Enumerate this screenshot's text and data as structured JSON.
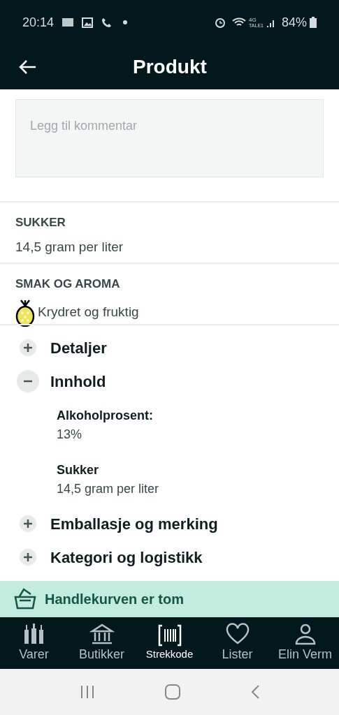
{
  "status_bar": {
    "time": "20:14",
    "network": "4G",
    "carrier": "TALE1",
    "battery": "84%"
  },
  "header": {
    "title": "Produkt"
  },
  "comment": {
    "placeholder": "Legg til kommentar"
  },
  "facts": [
    {
      "kind": "text",
      "label": "SUKKER",
      "value": "14,5 gram per liter"
    },
    {
      "kind": "flavor",
      "label": "SMAK OG AROMA",
      "value": "Krydret og fruktig"
    }
  ],
  "sections": [
    {
      "title": "Detaljer",
      "expanded": false
    },
    {
      "title": "Innhold",
      "expanded": true,
      "items": [
        {
          "label": "Alkoholprosent:",
          "value": "13%"
        },
        {
          "label": "Sukker",
          "value": "14,5 gram per liter"
        }
      ]
    },
    {
      "title": "Emballasje og merking",
      "expanded": false
    },
    {
      "title": "Kategori og logistikk",
      "expanded": false
    }
  ],
  "basket": {
    "text": "Handlekurven er tom"
  },
  "nav": [
    {
      "label": "Varer",
      "kind": "bottles",
      "selected": false
    },
    {
      "label": "Butikker",
      "kind": "store",
      "selected": false
    },
    {
      "label": "Strekkode",
      "kind": "barcode",
      "selected": true
    },
    {
      "label": "Lister",
      "kind": "heart",
      "selected": false
    },
    {
      "label": "Elin Verm",
      "kind": "person",
      "selected": false
    }
  ]
}
